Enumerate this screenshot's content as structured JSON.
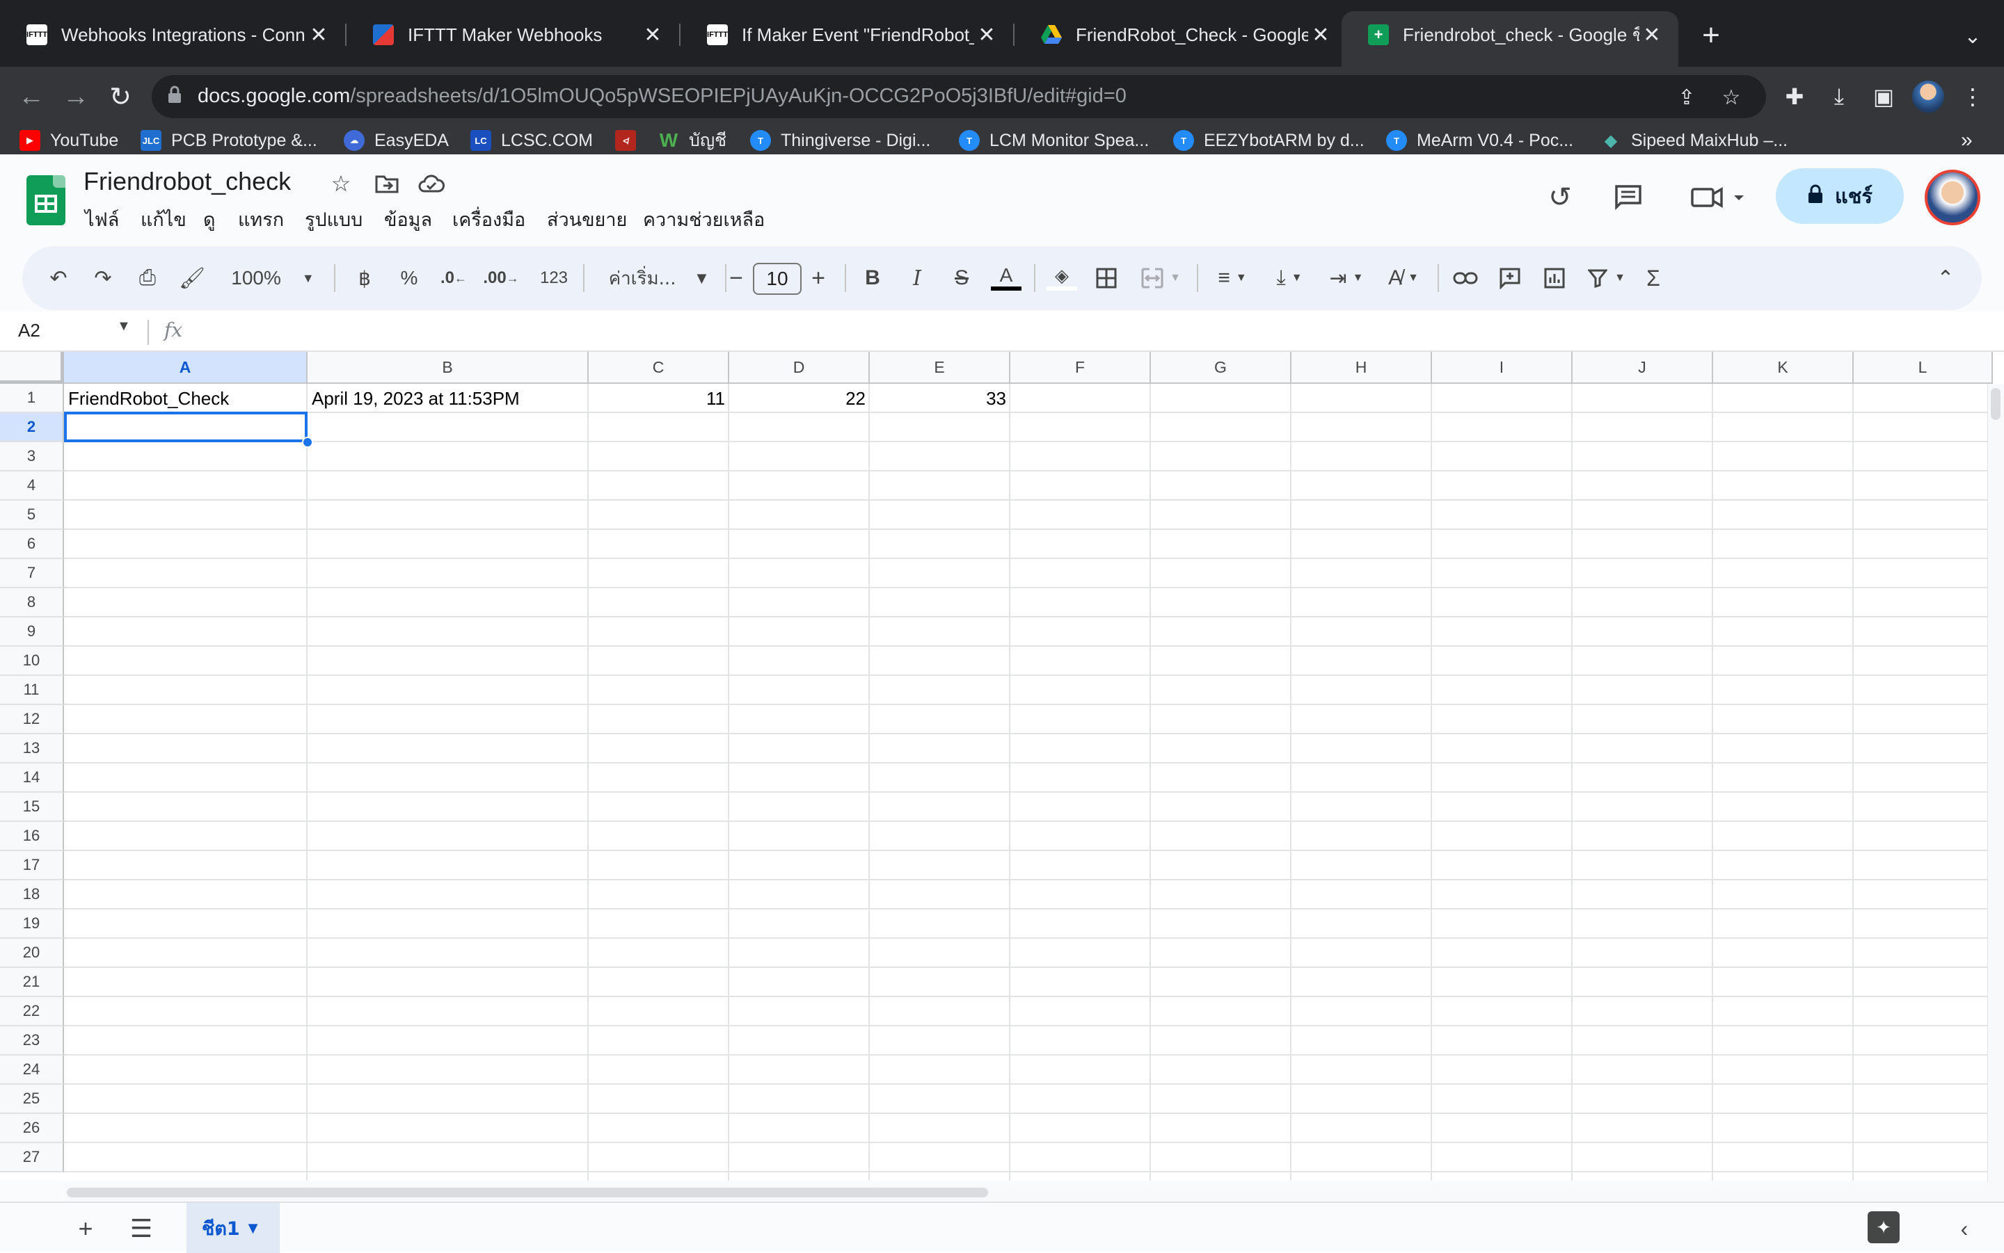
{
  "browser": {
    "tabs": [
      {
        "title": "Webhooks Integrations - Conn",
        "icon": "ifttt-favicon",
        "active": false
      },
      {
        "title": "IFTTT Maker Webhooks",
        "icon": "ifttt-maker-favicon",
        "active": false
      },
      {
        "title": "If Maker Event \"FriendRobot_C",
        "icon": "ifttt-favicon",
        "active": false
      },
      {
        "title": "FriendRobot_Check - Google Ti",
        "icon": "google-drive-favicon",
        "active": false
      },
      {
        "title": "Friendrobot_check - Google ชีต",
        "icon": "google-sheets-favicon",
        "active": true
      }
    ],
    "url_host": "docs.google.com",
    "url_path": "/spreadsheets/d/1O5lmOUQo5pWSEOPIEPjUAyAuKjn-OCCG2PoO5j3IBfU/edit#gid=0",
    "bookmarks": [
      {
        "label": "YouTube",
        "icon": "youtube-icon",
        "color": "#ff0000"
      },
      {
        "label": "PCB Prototype &...",
        "icon": "jlc-icon",
        "color": "#1f6fd0"
      },
      {
        "label": "EasyEDA",
        "icon": "easyeda-icon",
        "color": "#3f6ad8"
      },
      {
        "label": "LCSC.COM",
        "icon": "lcsc-icon",
        "color": "#1b4fbf"
      },
      {
        "label": "",
        "icon": "red-logo-icon",
        "color": "#b3261e"
      },
      {
        "label": "บัญชี",
        "icon": "w-icon",
        "color": "#2e7d32"
      },
      {
        "label": "Thingiverse - Digi...",
        "icon": "thingiverse-icon",
        "color": "#248bfb"
      },
      {
        "label": "LCM Monitor Spea...",
        "icon": "thingiverse-icon",
        "color": "#248bfb"
      },
      {
        "label": "EEZYbotARM by d...",
        "icon": "thingiverse-icon",
        "color": "#248bfb"
      },
      {
        "label": "MeArm V0.4 - Poc...",
        "icon": "thingiverse-icon",
        "color": "#248bfb"
      },
      {
        "label": "Sipeed MaixHub –...",
        "icon": "maixhub-icon",
        "color": "#4db6ac"
      }
    ],
    "bookmarks_more": "»"
  },
  "sheets": {
    "doc_title": "Friendrobot_check",
    "menu": [
      "ไฟล์",
      "แก้ไข",
      "ดู",
      "แทรก",
      "รูปแบบ",
      "ข้อมูล",
      "เครื่องมือ",
      "ส่วนขยาย",
      "ความช่วยเหลือ"
    ],
    "share_label": "แชร์",
    "toolbar": {
      "zoom": "100%",
      "currency": "฿",
      "percent": "%",
      "dec_decrease": ".0",
      "dec_increase": ".00",
      "number_format": "123",
      "font_name": "ค่าเริ่ม...",
      "font_size": "10"
    },
    "name_box": "A2",
    "fx_label": "fx",
    "columns": [
      "A",
      "B",
      "C",
      "D",
      "E",
      "F",
      "G",
      "H",
      "I",
      "J",
      "K",
      "L"
    ],
    "rows": [
      "1",
      "2",
      "3",
      "4",
      "5",
      "6",
      "7",
      "8",
      "9",
      "10",
      "11",
      "12",
      "13",
      "14",
      "15",
      "16",
      "17",
      "18",
      "19",
      "20",
      "21",
      "22",
      "23",
      "24",
      "25",
      "26",
      "27"
    ],
    "cells": {
      "A1": "FriendRobot_Check",
      "B1": "April 19, 2023 at 11:53PM",
      "C1": "11",
      "D1": "22",
      "E1": "33"
    },
    "selected_cell": "A2",
    "sheet_tab": "ชีต1",
    "colors": {
      "accent": "#1a73e8",
      "share_bg": "#c2e7ff",
      "sheets_green": "#0f9d58"
    }
  }
}
